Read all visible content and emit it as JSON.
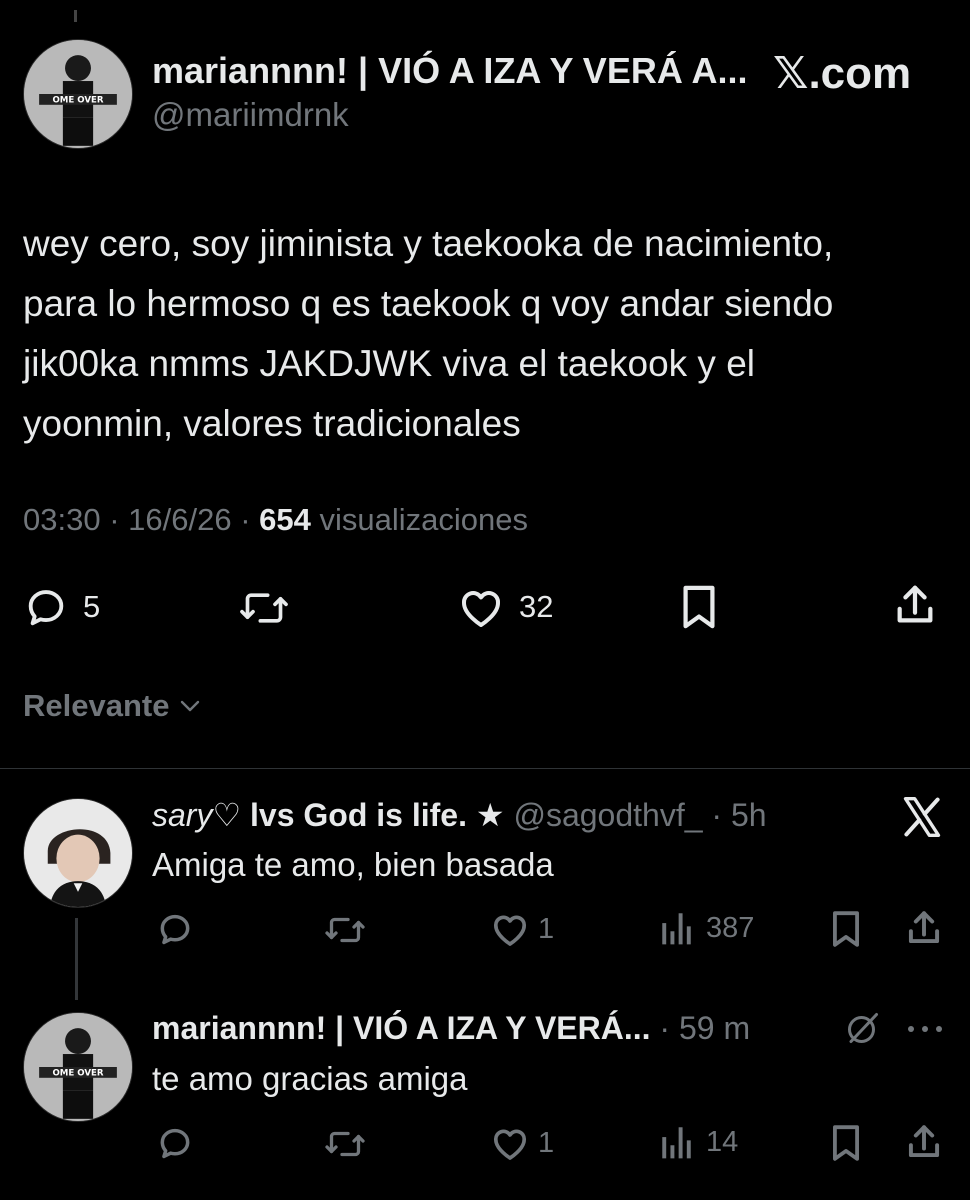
{
  "main_tweet": {
    "display_name": "mariannnn! | VIÓ A IZA Y VERÁ A...",
    "handle": "@mariimdrnk",
    "text_lines": [
      "wey cero, soy jiminista y taekooka de nacimiento,",
      "para lo hermoso q es taekook q voy andar siendo",
      "jik00ka nmms JAKDJWK viva el taekook y el",
      "yoonmin, valores tradicionales"
    ],
    "time": "03:30",
    "date": "16/6/26",
    "views_count": "654",
    "views_label": "visualizaciones",
    "replies": "5",
    "likes": "32"
  },
  "site_label": "𝕏.com",
  "sort": {
    "label": "Relevante"
  },
  "replies": [
    {
      "name_italic": "sary♡",
      "name_rest": " lvs God is life. ★",
      "handle": "@sagodthvf_",
      "time": "5h",
      "text": "Amiga te amo, bien basada",
      "likes": "1",
      "views": "387"
    },
    {
      "name": "mariannnn! | VIÓ A IZA Y VERÁ...",
      "time": "59 m",
      "text": "te amo gracias amiga",
      "likes": "1",
      "views": "14"
    }
  ],
  "colors": {
    "background": "#000000",
    "text": "#e7e9ea",
    "muted": "#71767b",
    "divider": "#2f3336"
  }
}
